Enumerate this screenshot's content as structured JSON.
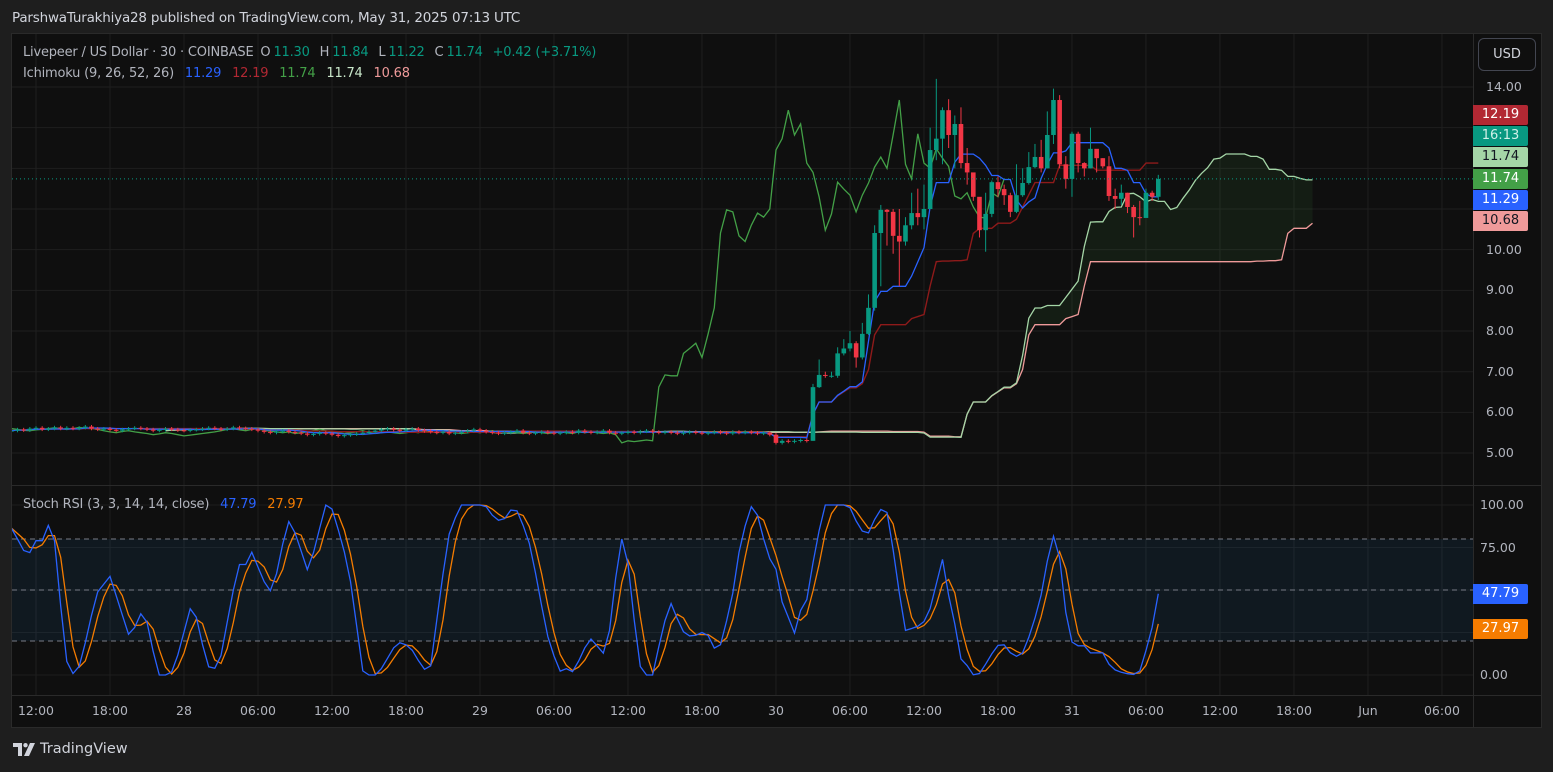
{
  "header": {
    "published": "ParshwaTurakhiya28 published on TradingView.com, May 31, 2025 07:13 UTC"
  },
  "legend": {
    "symbol": "Livepeer / US Dollar · 30 · COINBASE",
    "o_label": "O",
    "o": "11.30",
    "h_label": "H",
    "h": "11.84",
    "l_label": "L",
    "l": "11.22",
    "c_label": "C",
    "c": "11.74",
    "change": "+0.42 (+3.71%)",
    "ichimoku_label": "Ichimoku (9, 26, 52, 26)",
    "ichimoku_values": [
      "11.29",
      "12.19",
      "11.74",
      "11.74",
      "10.68"
    ],
    "stoch_label": "Stoch RSI (3, 3, 14, 14, close)",
    "stoch_k": "47.79",
    "stoch_d": "27.97"
  },
  "currency_button": "USD",
  "price_axis": [
    "14.00",
    "10.00",
    "9.00",
    "8.00",
    "7.00",
    "6.00",
    "5.00"
  ],
  "price_tags": [
    {
      "text": "12.19",
      "bg": "#b22833",
      "fg": "#ffffff"
    },
    {
      "text": "16:13",
      "bg": "#089981",
      "fg": "#d1f0e8"
    },
    {
      "text": "11.74",
      "bg": "#a5d6a7",
      "fg": "#131722"
    },
    {
      "text": "11.74",
      "bg": "#43a047",
      "fg": "#ffffff"
    },
    {
      "text": "11.29",
      "bg": "#2962ff",
      "fg": "#ffffff"
    },
    {
      "text": "10.68",
      "bg": "#ef9a9a",
      "fg": "#131722"
    }
  ],
  "stoch_axis": [
    "100.00",
    "75.00",
    "0.00"
  ],
  "stoch_tags": [
    {
      "text": "47.79",
      "bg": "#2962ff",
      "fg": "#ffffff"
    },
    {
      "text": "27.97",
      "bg": "#f57c00",
      "fg": "#ffffff"
    }
  ],
  "time_axis": [
    "12:00",
    "18:00",
    "28",
    "06:00",
    "12:00",
    "18:00",
    "29",
    "06:00",
    "12:00",
    "18:00",
    "30",
    "06:00",
    "12:00",
    "18:00",
    "31",
    "06:00",
    "12:00",
    "18:00",
    "Jun",
    "06:00"
  ],
  "footer": {
    "brand": "TradingView"
  },
  "colors": {
    "up": "#089981",
    "down": "#f23645",
    "tenkan": "#2962ff",
    "kijun": "#8e1a1a",
    "chikou": "#43a047",
    "spanA": "#a5d6a7",
    "spanB": "#ef9a9a",
    "stochK": "#2962ff",
    "stochD": "#f57c00"
  },
  "chart_data": {
    "type": "candlestick",
    "title": "Livepeer / US Dollar · 30 · COINBASE",
    "interval_hours": 0.5,
    "time_origin": "May 27 12:00 UTC",
    "start_t_hours": -2,
    "time_tick_step_hours": 6,
    "ylim": [
      5,
      14
    ],
    "last_price": 11.74,
    "last_open": 11.3,
    "flat_wick": 0.04,
    "closes": [
      5.55,
      5.58,
      5.56,
      5.6,
      5.62,
      5.58,
      5.6,
      5.63,
      5.6,
      5.62,
      5.6,
      5.62,
      5.65,
      5.6,
      5.58,
      5.6,
      5.57,
      5.55,
      5.58,
      5.6,
      5.62,
      5.6,
      5.58,
      5.55,
      5.57,
      5.6,
      5.58,
      5.56,
      5.55,
      5.57,
      5.58,
      5.6,
      5.62,
      5.6,
      5.58,
      5.6,
      5.63,
      5.61,
      5.6,
      5.58,
      5.55,
      5.52,
      5.5,
      5.53,
      5.55,
      5.52,
      5.5,
      5.48,
      5.45,
      5.47,
      5.5,
      5.48,
      5.45,
      5.42,
      5.44,
      5.46,
      5.48,
      5.5,
      5.52,
      5.55,
      5.58,
      5.6,
      5.57,
      5.55,
      5.58,
      5.6,
      5.56,
      5.54,
      5.52,
      5.5,
      5.52,
      5.48,
      5.5,
      5.52,
      5.55,
      5.58,
      5.55,
      5.52,
      5.5,
      5.48,
      5.5,
      5.52,
      5.55,
      5.5,
      5.48,
      5.5,
      5.52,
      5.5,
      5.48,
      5.5,
      5.52,
      5.5,
      5.55,
      5.52,
      5.5,
      5.52,
      5.55,
      5.5,
      5.48,
      5.5,
      5.52,
      5.5,
      5.53,
      5.55,
      5.52,
      5.5,
      5.52,
      5.5,
      5.48,
      5.5,
      5.52,
      5.5,
      5.48,
      5.5,
      5.52,
      5.5,
      5.48,
      5.52,
      5.5,
      5.52,
      5.5,
      5.48,
      5.5,
      5.45,
      5.25,
      5.3,
      5.28,
      5.3,
      5.32,
      5.3,
      6.62,
      6.92,
      6.9,
      6.9,
      7.45,
      7.57,
      7.7,
      7.35,
      7.93,
      8.57,
      10.41,
      10.98,
      10.93,
      10.34,
      10.2,
      10.6,
      10.9,
      10.8,
      11.0,
      12.45,
      12.73,
      13.43,
      12.82,
      13.09,
      12.13,
      11.9,
      11.3,
      10.48,
      10.88,
      11.66,
      11.49,
      11.34,
      10.93,
      11.34,
      11.64,
      12.03,
      12.28,
      12.0,
      12.82,
      13.68,
      12.1,
      11.74,
      12.85,
      12.13,
      12.0,
      12.48,
      12.25,
      12.05,
      11.32,
      11.25,
      11.4,
      11.05,
      10.8,
      10.78,
      11.4,
      11.3,
      11.74
    ],
    "active_start_index": 130,
    "active_highs": [
      6.7,
      7.3,
      7.0,
      7.0,
      7.6,
      7.8,
      8.0,
      7.75,
      8.2,
      8.9,
      10.6,
      11.1,
      11.0,
      11.0,
      11.0,
      10.8,
      11.4,
      11.5,
      11.6,
      13.0,
      14.2,
      13.5,
      13.7,
      13.3,
      13.5,
      12.5,
      11.6,
      11.2,
      11.4,
      11.7,
      11.8,
      11.6,
      11.4,
      12.1,
      12.0,
      12.4,
      12.6,
      12.7,
      13.4,
      13.96,
      13.8,
      12.3,
      12.9,
      12.9,
      12.15,
      13.0,
      12.45,
      12.25,
      12.3,
      11.5,
      11.6,
      11.4,
      11.1,
      11.2,
      11.5,
      11.45,
      11.84
    ],
    "active_lows": [
      5.3,
      6.6,
      6.85,
      6.85,
      6.85,
      7.4,
      7.5,
      7.1,
      7.3,
      7.9,
      8.5,
      9.1,
      10.1,
      9.9,
      9.1,
      10.1,
      10.5,
      10.6,
      10.5,
      11.0,
      12.2,
      12.1,
      12.5,
      12.0,
      12.0,
      11.6,
      11.2,
      10.3,
      9.95,
      10.8,
      11.3,
      11.1,
      10.8,
      10.9,
      11.3,
      11.6,
      12.0,
      11.9,
      12.0,
      12.6,
      12.0,
      11.5,
      11.3,
      11.9,
      11.8,
      12.0,
      11.9,
      12.0,
      11.2,
      11.0,
      11.1,
      10.9,
      10.3,
      10.6,
      10.8,
      11.2,
      11.22
    ],
    "ichimoku_periods": [
      9,
      26,
      52,
      26
    ],
    "stoch_rsi": {
      "ylim": [
        0,
        100
      ],
      "levels": [
        80,
        50,
        20
      ],
      "k_points": [
        [
          -1.9,
          86.5
        ],
        [
          -1.1,
          73.5
        ],
        [
          -0.5,
          72
        ],
        [
          -0.1,
          79
        ],
        [
          0.5,
          79
        ],
        [
          1.0,
          88
        ],
        [
          1.5,
          79
        ],
        [
          2.4,
          10
        ],
        [
          2.9,
          0
        ],
        [
          3.6,
          6
        ],
        [
          4.9,
          48
        ],
        [
          6.0,
          58
        ],
        [
          7.5,
          24
        ],
        [
          8.0,
          28
        ],
        [
          8.5,
          36
        ],
        [
          9.0,
          31
        ],
        [
          9.9,
          0
        ],
        [
          10.9,
          0
        ],
        [
          11.4,
          9
        ],
        [
          12.5,
          39
        ],
        [
          13.0,
          34
        ],
        [
          13.9,
          5
        ],
        [
          14.5,
          4
        ],
        [
          15.1,
          13
        ],
        [
          15.5,
          31
        ],
        [
          16.4,
          65
        ],
        [
          17.0,
          65
        ],
        [
          17.4,
          74
        ],
        [
          18.2,
          60
        ],
        [
          18.9,
          48
        ],
        [
          19.4,
          56
        ],
        [
          20.4,
          91
        ],
        [
          20.8,
          88
        ],
        [
          22.0,
          62
        ],
        [
          22.5,
          72
        ],
        [
          22.9,
          83
        ],
        [
          23.4,
          100
        ],
        [
          23.9,
          100
        ],
        [
          24.9,
          76
        ],
        [
          25.7,
          48
        ],
        [
          26.4,
          3
        ],
        [
          26.9,
          0
        ],
        [
          27.7,
          0
        ],
        [
          29.0,
          16
        ],
        [
          29.5,
          19
        ],
        [
          30.3,
          17
        ],
        [
          31.3,
          5
        ],
        [
          31.9,
          0
        ],
        [
          33.4,
          81
        ],
        [
          34.4,
          100
        ],
        [
          36.4,
          100
        ],
        [
          37.0,
          94
        ],
        [
          37.5,
          91
        ],
        [
          37.9,
          91
        ],
        [
          38.4,
          96
        ],
        [
          38.8,
          100
        ],
        [
          39.9,
          81
        ],
        [
          40.5,
          60
        ],
        [
          41.4,
          25
        ],
        [
          42.4,
          2
        ],
        [
          43.1,
          4
        ],
        [
          43.5,
          2
        ],
        [
          44.3,
          12
        ],
        [
          44.8,
          22
        ],
        [
          45.3,
          20
        ],
        [
          45.9,
          11
        ],
        [
          46.4,
          20
        ],
        [
          47.4,
          82
        ],
        [
          47.9,
          72
        ],
        [
          48.9,
          6
        ],
        [
          49.5,
          0
        ],
        [
          50.0,
          0
        ],
        [
          50.9,
          30
        ],
        [
          51.5,
          42
        ],
        [
          52.4,
          26
        ],
        [
          52.9,
          23
        ],
        [
          53.4,
          23
        ],
        [
          54.0,
          25
        ],
        [
          54.4,
          25
        ],
        [
          54.9,
          16
        ],
        [
          55.4,
          15
        ],
        [
          56.4,
          43
        ],
        [
          56.9,
          69
        ],
        [
          57.9,
          100
        ],
        [
          58.5,
          94
        ],
        [
          59.4,
          69
        ],
        [
          59.9,
          66
        ],
        [
          60.5,
          43
        ],
        [
          60.9,
          37
        ],
        [
          61.4,
          22
        ],
        [
          62.0,
          38
        ],
        [
          62.4,
          40
        ],
        [
          63.0,
          66
        ],
        [
          63.9,
          100
        ],
        [
          65.9,
          100
        ],
        [
          66.8,
          86
        ],
        [
          67.4,
          82
        ],
        [
          67.9,
          90
        ],
        [
          68.3,
          96
        ],
        [
          68.9,
          100
        ],
        [
          69.7,
          65
        ],
        [
          70.4,
          26
        ],
        [
          71.3,
          28
        ],
        [
          71.9,
          30
        ],
        [
          72.5,
          39
        ],
        [
          73.5,
          68
        ],
        [
          74.0,
          47
        ],
        [
          74.4,
          35
        ],
        [
          74.9,
          10
        ],
        [
          75.4,
          7
        ],
        [
          75.9,
          0
        ],
        [
          76.6,
          1
        ],
        [
          77.2,
          9
        ],
        [
          77.9,
          17
        ],
        [
          78.4,
          19
        ],
        [
          78.8,
          14
        ],
        [
          79.5,
          11
        ],
        [
          80.0,
          13
        ],
        [
          80.6,
          24
        ],
        [
          81.4,
          43
        ],
        [
          82.4,
          83
        ],
        [
          82.9,
          76
        ],
        [
          83.4,
          41
        ],
        [
          83.9,
          20
        ],
        [
          84.4,
          17
        ],
        [
          84.9,
          18
        ],
        [
          85.5,
          13
        ],
        [
          86.5,
          13
        ],
        [
          86.9,
          7
        ],
        [
          87.5,
          3
        ],
        [
          88.2,
          1
        ],
        [
          89.4,
          0
        ],
        [
          90.4,
          24
        ],
        [
          91.0,
          47.79
        ]
      ]
    }
  }
}
